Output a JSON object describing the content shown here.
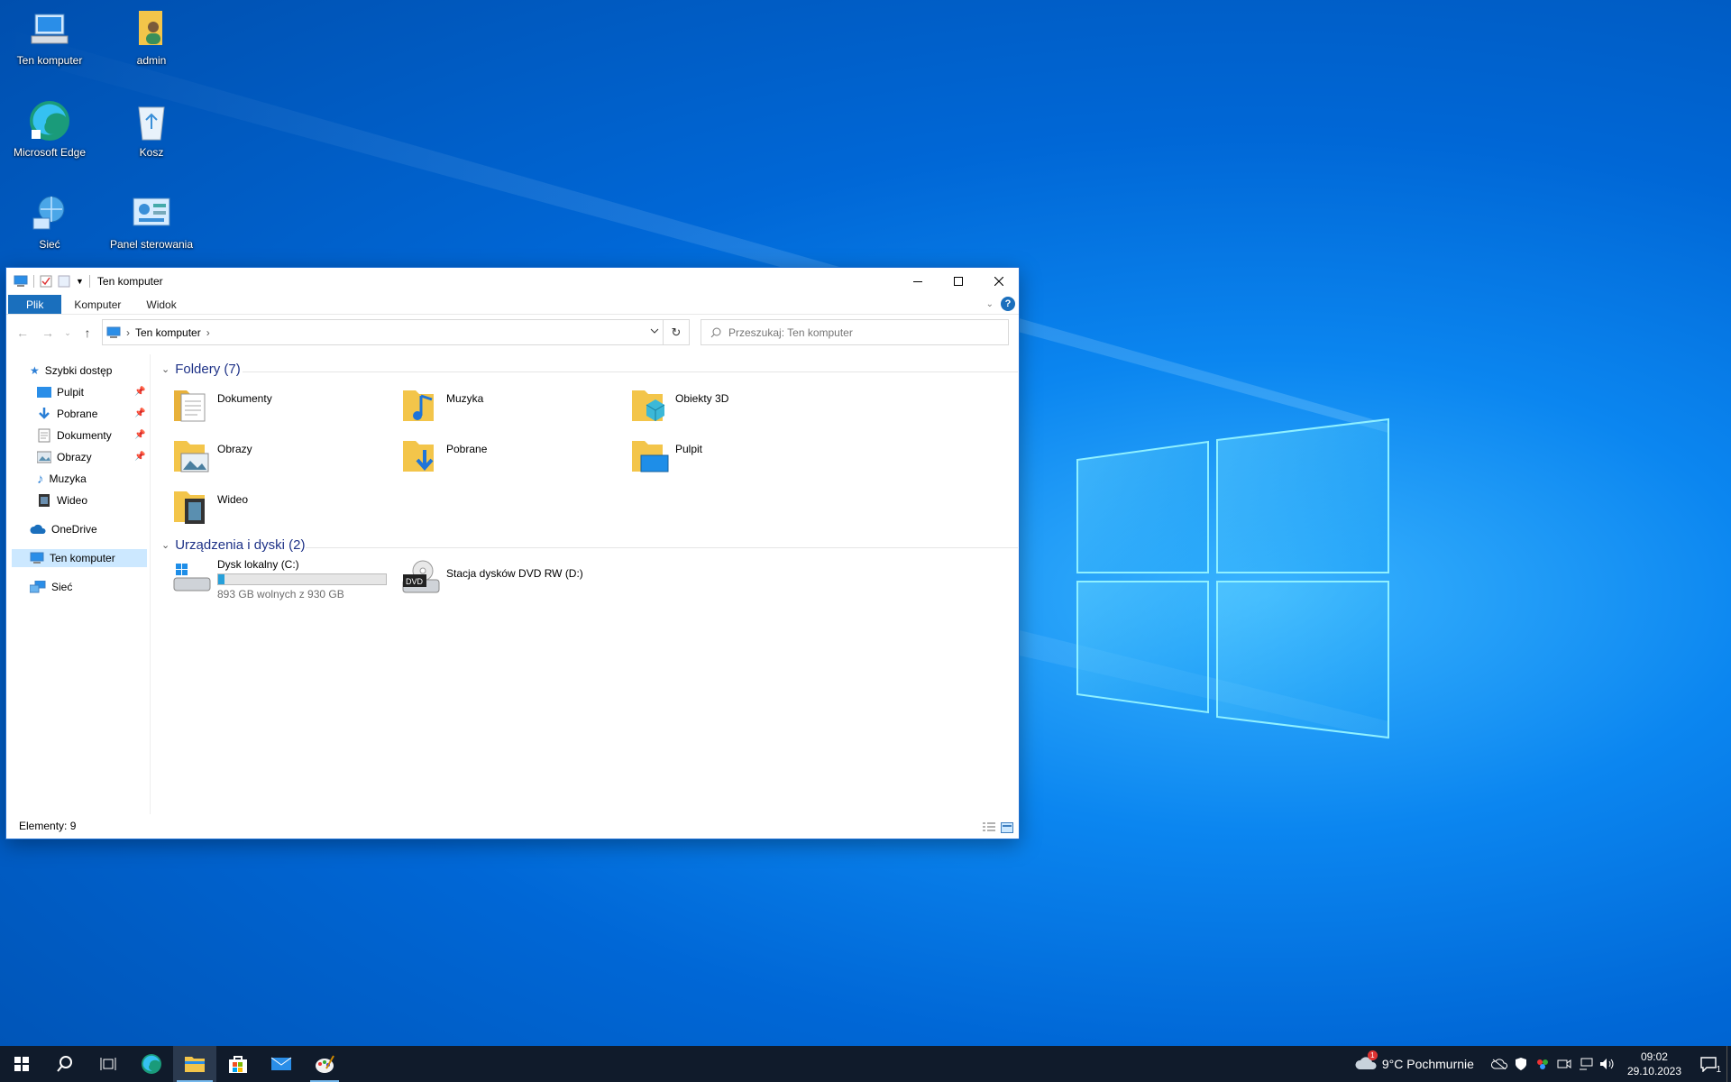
{
  "desktop": {
    "icons": [
      {
        "label": "Ten komputer",
        "icon": "computer-icon"
      },
      {
        "label": "admin",
        "icon": "user-folder-icon"
      },
      {
        "label": "Microsoft Edge",
        "icon": "edge-icon"
      },
      {
        "label": "Kosz",
        "icon": "recycle-bin-icon"
      },
      {
        "label": "Sieć",
        "icon": "network-icon"
      },
      {
        "label": "Panel sterowania",
        "icon": "control-panel-icon"
      }
    ]
  },
  "window": {
    "title": "Ten komputer",
    "ribbon_tabs": [
      "Plik",
      "Komputer",
      "Widok"
    ],
    "breadcrumb": "Ten komputer",
    "search_placeholder": "Przeszukaj: Ten komputer",
    "nav": {
      "quick_access": "Szybki dostęp",
      "quick_items": [
        "Pulpit",
        "Pobrane",
        "Dokumenty",
        "Obrazy",
        "Muzyka",
        "Wideo"
      ],
      "onedrive": "OneDrive",
      "this_pc": "Ten komputer",
      "network": "Sieć"
    },
    "folders_header": "Foldery (7)",
    "folders": [
      "Dokumenty",
      "Muzyka",
      "Obiekty 3D",
      "Obrazy",
      "Pobrane",
      "Pulpit",
      "Wideo"
    ],
    "devices_header": "Urządzenia i dyski (2)",
    "drives": [
      {
        "name": "Dysk lokalny (C:)",
        "free_text": "893 GB wolnych z 930 GB",
        "used_fraction": 0.04
      },
      {
        "name": "Stacja dysków DVD RW (D:)"
      }
    ],
    "dvd_label": "DVD",
    "status": "Elementy: 9"
  },
  "taskbar": {
    "weather": "9°C  Pochmurnie",
    "weather_badge": "1",
    "time": "09:02",
    "date": "29.10.2023",
    "notification_count": "1"
  },
  "colors": {
    "accent": "#1a6fbd",
    "selection": "#cce8ff",
    "folder": "#f3c54a",
    "taskbar": "#101b2b",
    "drive_bar": "#26a0da"
  }
}
